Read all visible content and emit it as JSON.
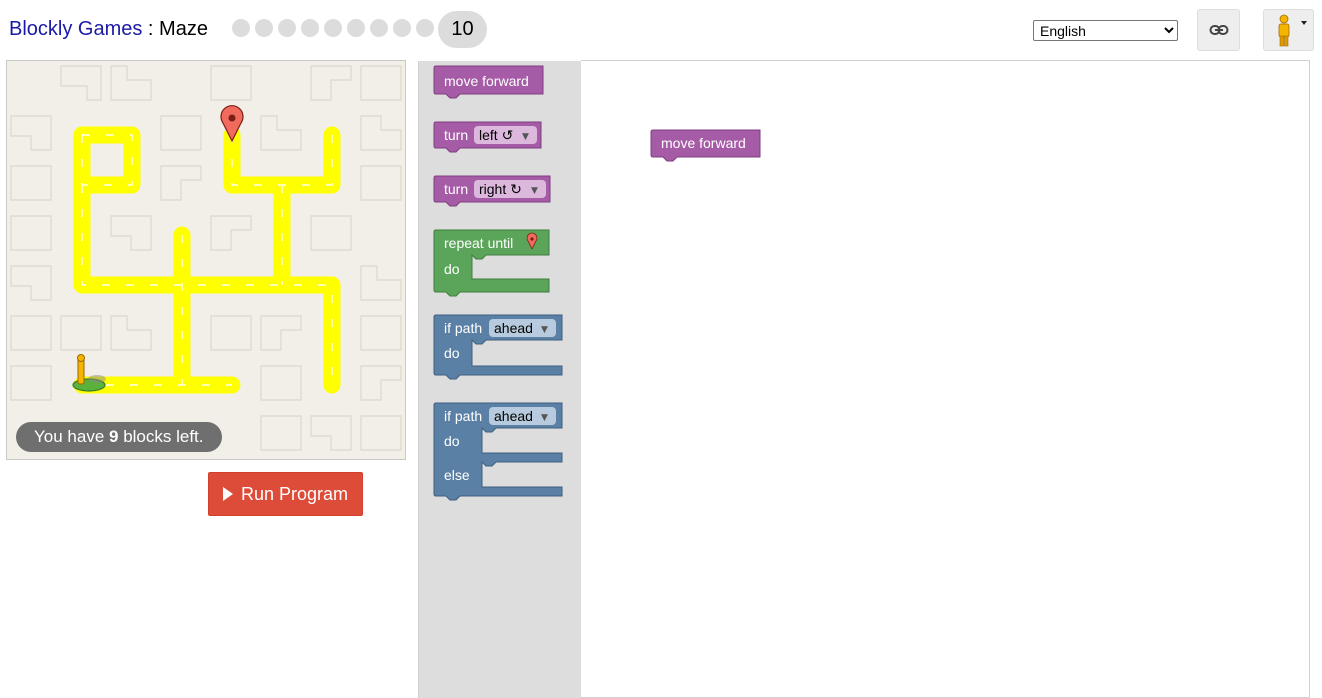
{
  "header": {
    "app_name": "Blockly Games",
    "separator": " : ",
    "game_name": "Maze",
    "levels": [
      "1",
      "2",
      "3",
      "4",
      "5",
      "6",
      "7",
      "8",
      "9",
      "10"
    ],
    "current_level": "10",
    "language_options": [
      "English"
    ],
    "language_selected": "English",
    "link_icon": "link-icon",
    "avatar_icon": "pegman-avatar-icon"
  },
  "maze": {
    "capacity_prefix": "You have ",
    "capacity_count": "9",
    "capacity_suffix": " blocks left."
  },
  "controls": {
    "run_label": "Run Program"
  },
  "toolbox": {
    "move_forward": "move forward",
    "turn": "turn",
    "turn_left_option": "left ↺",
    "turn_right_option": "right ↻",
    "repeat_until": "repeat until",
    "do": "do",
    "if_path": "if path",
    "path_option": "ahead",
    "else": "else"
  },
  "workspace": {
    "blocks": [
      "move forward"
    ]
  },
  "colors": {
    "motion_block": "#a55ba5",
    "loop_block": "#5ba55b",
    "logic_block": "#5b80a5",
    "run_button": "#dd4b39",
    "path": "#ffff00",
    "level_dot": "#dcdcdc"
  }
}
